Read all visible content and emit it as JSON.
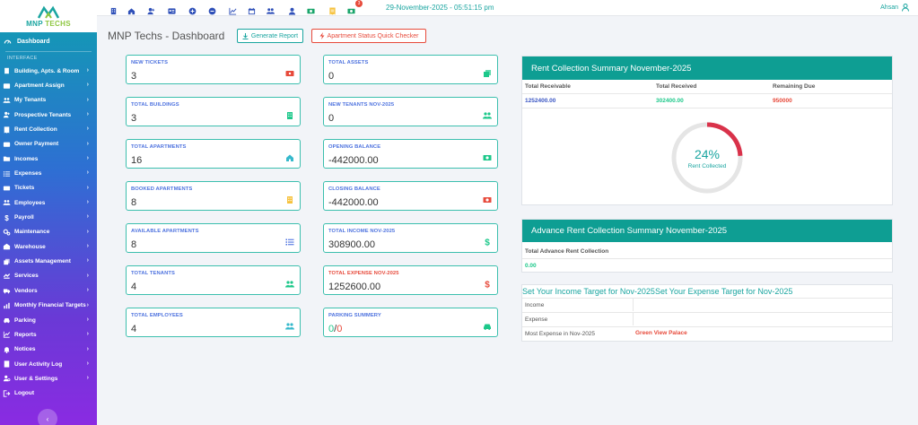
{
  "brand": {
    "name_main": "MNP",
    "name_sub": " TECHS"
  },
  "topbar": {
    "date_time": "29-November-2025 - 05:51:15 pm",
    "badge_count": "3",
    "user_name": "Ahsan",
    "icons": [
      "building-icon",
      "home-icon",
      "add-user-icon",
      "id-card-icon",
      "plus-circle-icon",
      "minus-circle-icon",
      "chart-icon",
      "calendar-icon",
      "users-icon",
      "user-icon",
      "money-icon",
      "receipt-icon",
      "cash-icon"
    ]
  },
  "sidebar": {
    "dashboard_label": "Dashboard",
    "section_heading": "INTERFACE",
    "items": [
      {
        "label": "Building, Apts. & Room",
        "icon": "building-icon"
      },
      {
        "label": "Apartment Assign",
        "icon": "id-card-icon"
      },
      {
        "label": "My Tenants",
        "icon": "users-icon"
      },
      {
        "label": "Prospective Tenants",
        "icon": "user-plus-icon"
      },
      {
        "label": "Rent Collection",
        "icon": "receipt-icon"
      },
      {
        "label": "Owner Payment",
        "icon": "wallet-icon"
      },
      {
        "label": "Incomes",
        "icon": "folder-icon"
      },
      {
        "label": "Expenses",
        "icon": "list-icon"
      },
      {
        "label": "Tickets",
        "icon": "ticket-icon"
      },
      {
        "label": "Employees",
        "icon": "employees-icon"
      },
      {
        "label": "Payroll",
        "icon": "dollar-icon"
      },
      {
        "label": "Maintenance",
        "icon": "cogs-icon"
      },
      {
        "label": "Warehouse",
        "icon": "warehouse-icon"
      },
      {
        "label": "Assets Management",
        "icon": "assets-icon"
      },
      {
        "label": "Services",
        "icon": "services-icon"
      },
      {
        "label": "Vendors",
        "icon": "vendors-icon"
      },
      {
        "label": "Monthly Financial Targets",
        "icon": "target-icon"
      },
      {
        "label": "Parking",
        "icon": "car-icon"
      },
      {
        "label": "Reports",
        "icon": "reports-icon"
      },
      {
        "label": "Notices",
        "icon": "bell-icon"
      },
      {
        "label": "User Activity Log",
        "icon": "log-icon"
      },
      {
        "label": "User & Settings",
        "icon": "user-cog-icon"
      },
      {
        "label": "Logout",
        "icon": "logout-icon"
      }
    ]
  },
  "page": {
    "title": "MNP Techs - Dashboard",
    "generate_report": "Generate Report",
    "apt_status": "Apartment Status Quick Checker"
  },
  "cards_left": [
    {
      "label": "NEW TICKETS",
      "value": "3",
      "icon": "ticket-icon",
      "color": "#e74a3b"
    },
    {
      "label": "TOTAL BUILDINGS",
      "value": "3",
      "icon": "building-icon",
      "color": "#1cc88a"
    },
    {
      "label": "TOTAL APARTMENTS",
      "value": "16",
      "icon": "home-icon",
      "color": "#36b9cc"
    },
    {
      "label": "BOOKED APARTMENTS",
      "value": "8",
      "icon": "building-icon",
      "color": "#f6c23e"
    },
    {
      "label": "AVAILABLE APARTMENTS",
      "value": "8",
      "icon": "list-icon",
      "color": "#4e73df"
    },
    {
      "label": "TOTAL TENANTS",
      "value": "4",
      "icon": "users-icon",
      "color": "#1cc88a"
    },
    {
      "label": "TOTAL EMPLOYEES",
      "value": "4",
      "icon": "users-icon",
      "color": "#36b9cc"
    }
  ],
  "cards_right": [
    {
      "label": "TOTAL ASSETS",
      "value": "0",
      "icon": "assets-icon",
      "color": "#1cc88a"
    },
    {
      "label": "NEW TENANTS NOV-2025",
      "value": "0",
      "icon": "users-icon",
      "color": "#1cc88a"
    },
    {
      "label": "OPENING BALANCE",
      "value": "-442000.00",
      "icon": "money-icon",
      "color": "#1cc88a"
    },
    {
      "label": "CLOSING BALANCE",
      "value": "-442000.00",
      "icon": "money-icon",
      "color": "#e74a3b"
    },
    {
      "label": "TOTAL INCOME NOV-2025",
      "value": "308900.00",
      "icon": "dollar-icon",
      "color": "#1cc88a"
    },
    {
      "label": "TOTAL EXPENSE NOV-2025",
      "value": "1252600.00",
      "icon": "dollar-icon",
      "color": "#e74a3b",
      "label_red": true
    },
    {
      "label": "PARKING SUMMERY",
      "value_a": "0",
      "sep": "/",
      "value_b": "0",
      "icon": "car-icon",
      "color": "#1cc88a"
    }
  ],
  "rent_summary": {
    "title": "Rent Collection Summary November-2025",
    "headers": [
      "Total Receivable",
      "Total Received",
      "Remaining Due"
    ],
    "values": [
      "1252400.00",
      "302400.00",
      "950000"
    ],
    "percent_value": 24,
    "percent_text": "24%",
    "caption": "Rent Collected"
  },
  "advance_summary": {
    "title": "Advance Rent Collection Summary November-2025",
    "header": "Total Advance Rent Collection",
    "value": "0.00"
  },
  "targets": {
    "income_link": "Set Your Income Target for Nov-2025",
    "expense_link": "Set Your Expense Target for Nov-2025",
    "rows": [
      {
        "key": "Income",
        "value": ""
      },
      {
        "key": "Expense",
        "value": ""
      },
      {
        "key": "Most Expense in Nov-2025",
        "value": "Green View Palace"
      }
    ]
  }
}
